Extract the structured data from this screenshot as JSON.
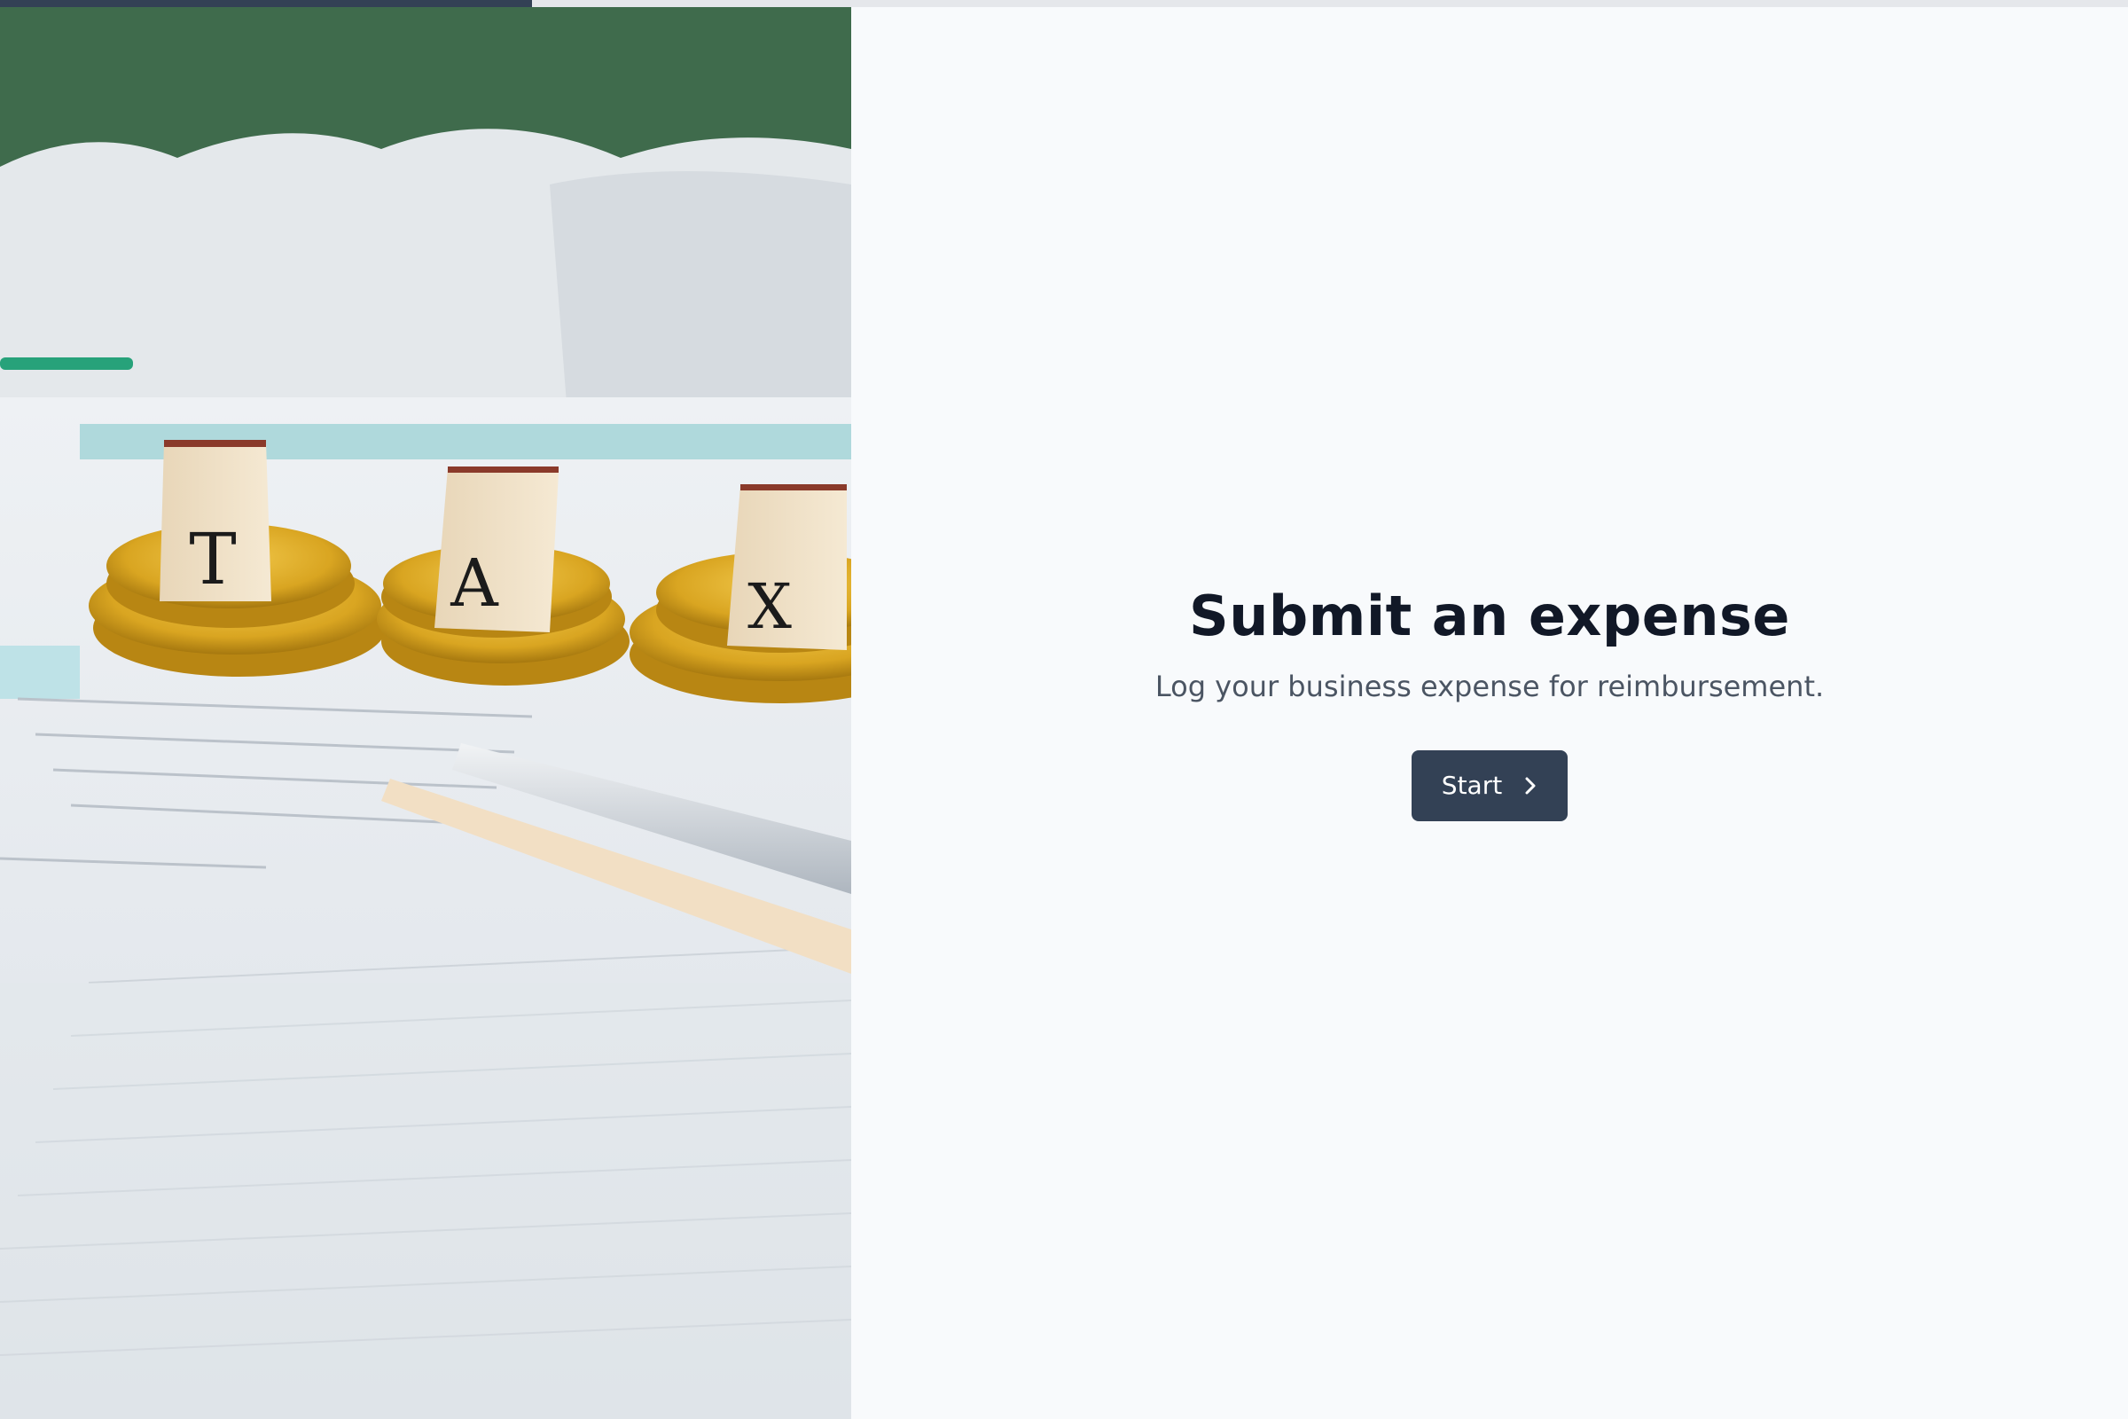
{
  "progress": {
    "fraction": 0.25
  },
  "hero": {
    "letters": [
      "T",
      "A",
      "X"
    ]
  },
  "welcome": {
    "title": "Submit an expense",
    "subtitle": "Log your business expense for reimbursement.",
    "start_label": "Start",
    "start_icon": "chevron-right-icon"
  },
  "colors": {
    "accent": "#334155",
    "title": "#111827",
    "subtitle": "#4b5563",
    "background": "#f8fafc",
    "progress_track": "#e5e7eb"
  }
}
